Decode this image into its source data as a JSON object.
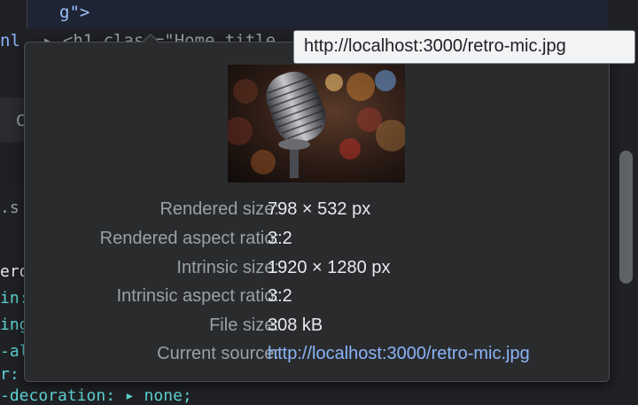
{
  "background": {
    "code_top_line": "g\">",
    "under_row_tag": "▸ <h1 class=\"Home_title",
    "left_tab_text": "nl",
    "left_gutter_c": "C",
    "left_file_text": ".s",
    "code_lines": [
      "ero",
      "in:",
      "ing",
      "-al",
      "r:",
      "-decoration: ▸ none;"
    ],
    "overflow_dots": "..."
  },
  "popover": {
    "image_alt": "retro microphone thumbnail",
    "rows": [
      {
        "label": "Rendered size:",
        "value": "798 × 532 px"
      },
      {
        "label": "Rendered aspect ratio:",
        "value": "3:2"
      },
      {
        "label": "Intrinsic size:",
        "value": "1920 × 1280 px"
      },
      {
        "label": "Intrinsic aspect ratio:",
        "value": "3:2"
      },
      {
        "label": "File size:",
        "value": "308 kB"
      },
      {
        "label": "Current source:",
        "value": "http://localhost:3000/retro-mic.jpg"
      }
    ]
  },
  "tooltip": {
    "url": "http://localhost:3000/retro-mic.jpg"
  },
  "colors": {
    "popover_bg": "#2a2b2d",
    "label": "#9aa0a6",
    "value": "#e8eaed",
    "link": "#8ab4f8",
    "tooltip_bg": "#f1f3f4"
  }
}
